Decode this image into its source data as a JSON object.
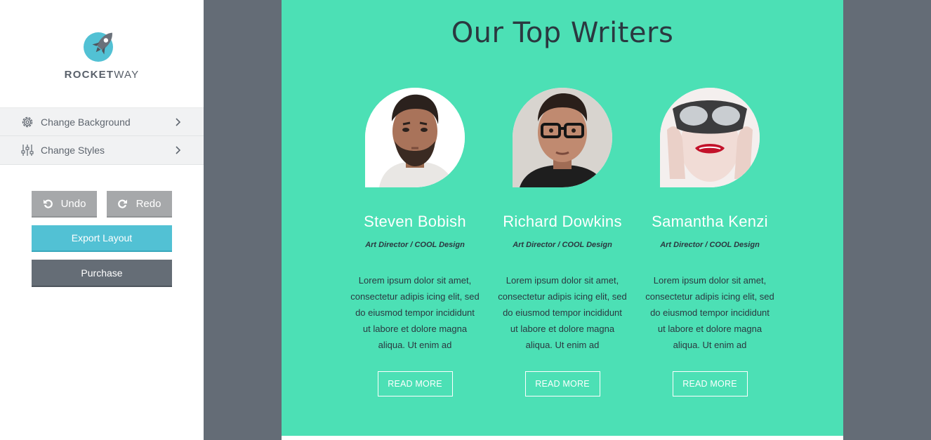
{
  "brand": {
    "name_bold": "ROCKET",
    "name_light": "WAY",
    "icon": "rocket-icon",
    "accent": "#52c1d4"
  },
  "sidebar": {
    "menu": [
      {
        "label": "Change Background",
        "icon": "gear-icon"
      },
      {
        "label": "Change Styles",
        "icon": "sliders-icon"
      }
    ],
    "buttons": {
      "undo": "Undo",
      "redo": "Redo",
      "export": "Export Layout",
      "purchase": "Purchase"
    }
  },
  "section": {
    "title": "Our Top Writers",
    "background": "#4ce0b5",
    "writers": [
      {
        "name": "Steven Bobish",
        "role": "Art Director / COOL Design",
        "bio": "Lorem ipsum dolor sit amet, consectetur adipis icing elit, sed do eiusmod tempor incididunt ut labore et dolore magna aliqua. Ut enim ad",
        "cta": "READ MORE"
      },
      {
        "name": "Richard Dowkins",
        "role": "Art Director / COOL Design",
        "bio": "Lorem ipsum dolor sit amet, consectetur adipis icing elit, sed do eiusmod tempor incididunt ut labore et dolore magna aliqua. Ut enim ad",
        "cta": "READ MORE"
      },
      {
        "name": "Samantha Kenzi",
        "role": "Art Director / COOL Design",
        "bio": "Lorem ipsum dolor sit amet, consectetur adipis icing elit, sed do eiusmod tempor incididunt ut labore et dolore magna aliqua. Ut enim ad",
        "cta": "READ MORE"
      }
    ]
  }
}
